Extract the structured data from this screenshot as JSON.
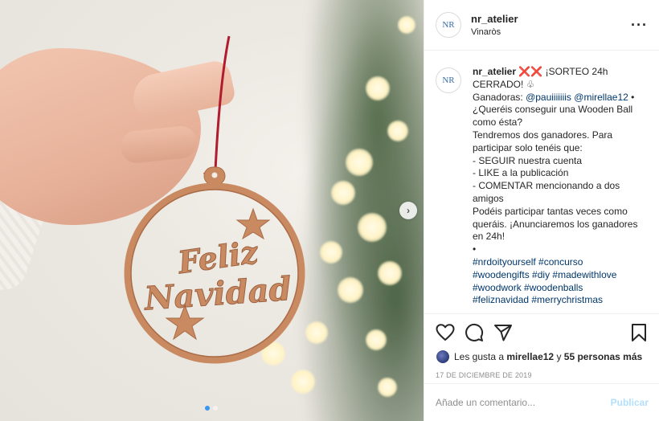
{
  "header": {
    "avatar_text": "NR",
    "username": "nr_atelier",
    "location": "Vinaròs",
    "more_icon": "more-horizontal-icon"
  },
  "caption": {
    "username": "nr_atelier",
    "title_emojis": "❌❌",
    "title": "¡SORTEO 24h CERRADO! ♧",
    "winners_label": "Ganadoras:",
    "winner_1": "@pauiiiiiiis",
    "winner_2": "@mirellae12",
    "bullet": "•",
    "lines": [
      "¿Queréis conseguir una Wooden Ball como ésta?",
      "Tendremos dos ganadores. Para participar solo tenéis que:",
      "- SEGUIR nuestra cuenta",
      "- LIKE a la publicación",
      "- COMENTAR mencionando a dos amigos",
      "Podéis participar tantas veces como queráis. ¡Anunciaremos los ganadores en 24h!",
      "•"
    ],
    "hashtags": [
      "#nrdoityourself #concurso",
      "#woodengifts #diy #madewithlove",
      "#woodwork #woodenballs",
      "#feliznavidad #merrychristmas"
    ]
  },
  "photo": {
    "ornament_text_1": "Feliz",
    "ornament_text_2": "Navidad",
    "carousel_count": 2,
    "carousel_active": 1
  },
  "actions": {
    "icons": [
      "heart-icon",
      "comment-icon",
      "share-icon",
      "bookmark-icon"
    ],
    "likes_prefix": "Les gusta a",
    "likes_user": "mirellae12",
    "likes_joiner": "y",
    "likes_others": "55 personas más",
    "date": "17 DE DICIEMBRE DE 2019"
  },
  "comment": {
    "placeholder": "Añade un comentario...",
    "post_label": "Publicar"
  },
  "colors": {
    "link": "#00376b",
    "post_disabled": "#b2dffc",
    "wood": "#c98a62",
    "string": "#b01c2e"
  }
}
